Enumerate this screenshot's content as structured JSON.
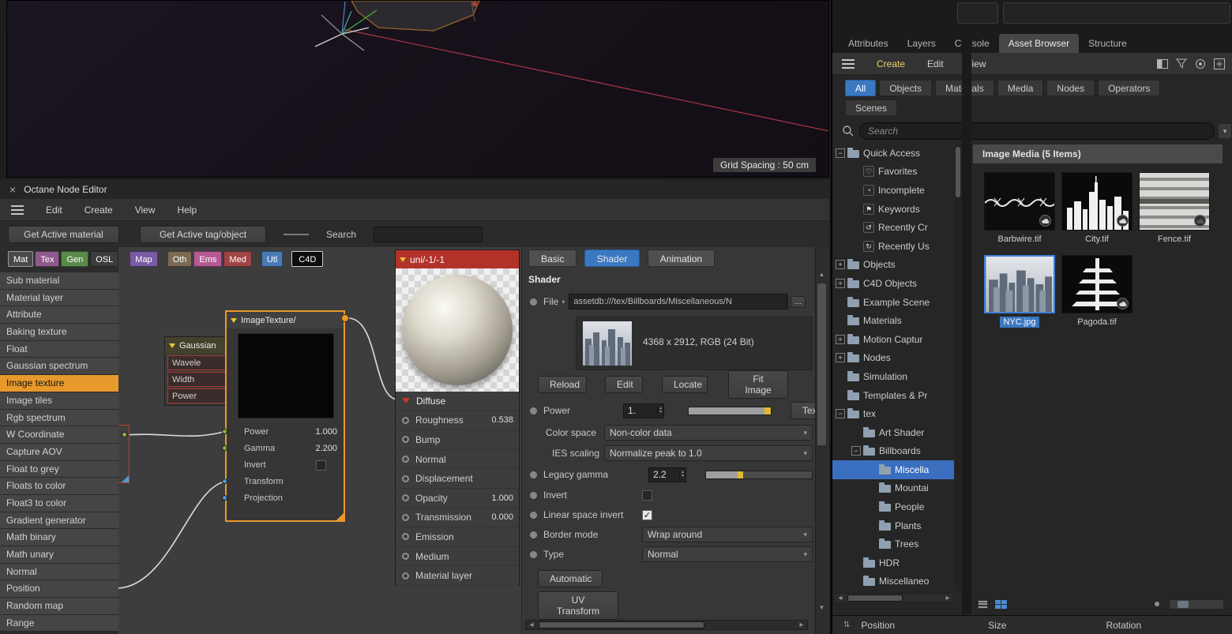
{
  "viewport": {
    "grid_label": "Grid Spacing : 50 cm"
  },
  "node_editor": {
    "title": "Octane Node Editor",
    "close": "×",
    "menu": {
      "edit": "Edit",
      "create": "Create",
      "view": "View",
      "help": "Help"
    },
    "toolbar": {
      "get_material": "Get Active material",
      "get_tag": "Get Active tag/object",
      "search_label": "Search",
      "search_value": ""
    },
    "category_tabs": [
      {
        "label": "Mat",
        "color": "#4a4a4a"
      },
      {
        "label": "Tex",
        "color": "#8e5a8e"
      },
      {
        "label": "Gen",
        "color": "#5a8a4a"
      },
      {
        "label": "OSL",
        "color": "#3d3d3d"
      },
      {
        "label": "Map",
        "color": "#7a5aa5"
      },
      {
        "label": "Oth",
        "color": "#7a6a52"
      },
      {
        "label": "Ems",
        "color": "#b55a95"
      },
      {
        "label": "Med",
        "color": "#a04545"
      },
      {
        "label": "Utl",
        "color": "#4a7ab5"
      },
      {
        "label": "C4D",
        "color": "#0d0d0d"
      }
    ],
    "node_list": {
      "items": [
        "Sub material",
        "Material layer",
        "Attribute",
        "Baking texture",
        "Float",
        "Gaussian spectrum",
        "Image texture",
        "Image tiles",
        "Rgb spectrum",
        "W Coordinate",
        "Capture AOV",
        "Float to grey",
        "Floats to color",
        "Float3 to color",
        "Gradient generator",
        "Math binary",
        "Math unary",
        "Normal",
        "Position",
        "Random map",
        "Range"
      ],
      "selected": "Image texture"
    },
    "gaussian_node": {
      "title": "Gaussian",
      "rows": [
        "Wavele",
        "Width",
        "Power"
      ]
    },
    "image_texture_node": {
      "title": "ImageTexture/",
      "power_label": "Power",
      "power_value": "1.000",
      "gamma_label": "Gamma",
      "gamma_value": "2.200",
      "invert_label": "Invert",
      "transform_label": "Transform",
      "projection_label": "Projection"
    },
    "material_node": {
      "title": "uni/-1/-1",
      "channels": [
        {
          "label": "Diffuse",
          "value": ""
        },
        {
          "label": "Roughness",
          "value": "0.538"
        },
        {
          "label": "Bump",
          "value": ""
        },
        {
          "label": "Normal",
          "value": ""
        },
        {
          "label": "Displacement",
          "value": ""
        },
        {
          "label": "Opacity",
          "value": "1.000"
        },
        {
          "label": "Transmission",
          "value": "0.000"
        },
        {
          "label": "Emission",
          "value": ""
        },
        {
          "label": "Medium",
          "value": ""
        },
        {
          "label": "Material layer",
          "value": ""
        }
      ]
    },
    "inspector": {
      "tab_basic": "Basic",
      "tab_shader": "Shader",
      "tab_animation": "Animation",
      "section": "Shader",
      "file_label": "File",
      "file_value": "assetdb:///tex/Billboards/Miscellaneous/N",
      "browse_label": "...",
      "image_info": "4368 x 2912, RGB (24 Bit)",
      "reload": "Reload",
      "edit": "Edit",
      "locate": "Locate",
      "fit_image": "Fit Image",
      "power_label": "Power",
      "power_value": "1.",
      "tex_label": "Tex",
      "color_space_label": "Color space",
      "color_space_value": "Non-color data",
      "ies_label": "IES scaling",
      "ies_value": "Normalize peak to 1.0",
      "gamma_label": "Legacy gamma",
      "gamma_value": "2.2",
      "invert_label": "Invert",
      "invert_checked": false,
      "lsi_label": "Linear space invert",
      "lsi_checked": true,
      "check_glyph": "✓",
      "border_label": "Border mode",
      "border_value": "Wrap around",
      "type_label": "Type",
      "type_value": "Normal",
      "automatic": "Automatic",
      "uv_transform": "UV Transform"
    }
  },
  "asset_browser": {
    "tabs": [
      "Attributes",
      "Layers",
      "Console",
      "Asset Browser",
      "Structure"
    ],
    "active_tab": "Asset Browser",
    "menu": {
      "create": "Create",
      "edit": "Edit",
      "view": "View"
    },
    "filters": [
      "All",
      "Objects",
      "Materials",
      "Media",
      "Nodes",
      "Operators",
      "Scenes"
    ],
    "active_filter": "All",
    "search_placeholder": "Search",
    "tree": [
      {
        "label": "Quick Access",
        "expand": "−"
      },
      {
        "label": "Favorites"
      },
      {
        "label": "Incomplete"
      },
      {
        "label": "Keywords"
      },
      {
        "label": "Recently Cr"
      },
      {
        "label": "Recently Us"
      },
      {
        "label": "Objects",
        "expand": "+"
      },
      {
        "label": "C4D Objects",
        "expand": "+"
      },
      {
        "label": "Example Scene"
      },
      {
        "label": "Materials"
      },
      {
        "label": "Motion Captur",
        "expand": "+"
      },
      {
        "label": "Nodes",
        "expand": "+"
      },
      {
        "label": "Simulation"
      },
      {
        "label": "Templates & Pr"
      },
      {
        "label": "tex",
        "expand": "−"
      },
      {
        "label": "Art Shader"
      },
      {
        "label": "Billboards",
        "expand": "−"
      },
      {
        "label": "Miscella",
        "selected": true
      },
      {
        "label": "Mountai"
      },
      {
        "label": "People"
      },
      {
        "label": "Plants"
      },
      {
        "label": "Trees"
      },
      {
        "label": "HDR"
      },
      {
        "label": "Miscellaneo"
      }
    ],
    "content": {
      "header": "Image Media (5 Items)",
      "items": [
        {
          "name": "Barbwire.tif"
        },
        {
          "name": "City.tif"
        },
        {
          "name": "Fence.tif"
        },
        {
          "name": "NYC.jpg",
          "selected": true
        },
        {
          "name": "Pagoda.tif"
        }
      ]
    },
    "footer": {
      "position": "Position",
      "size": "Size",
      "rotation": "Rotation"
    }
  }
}
